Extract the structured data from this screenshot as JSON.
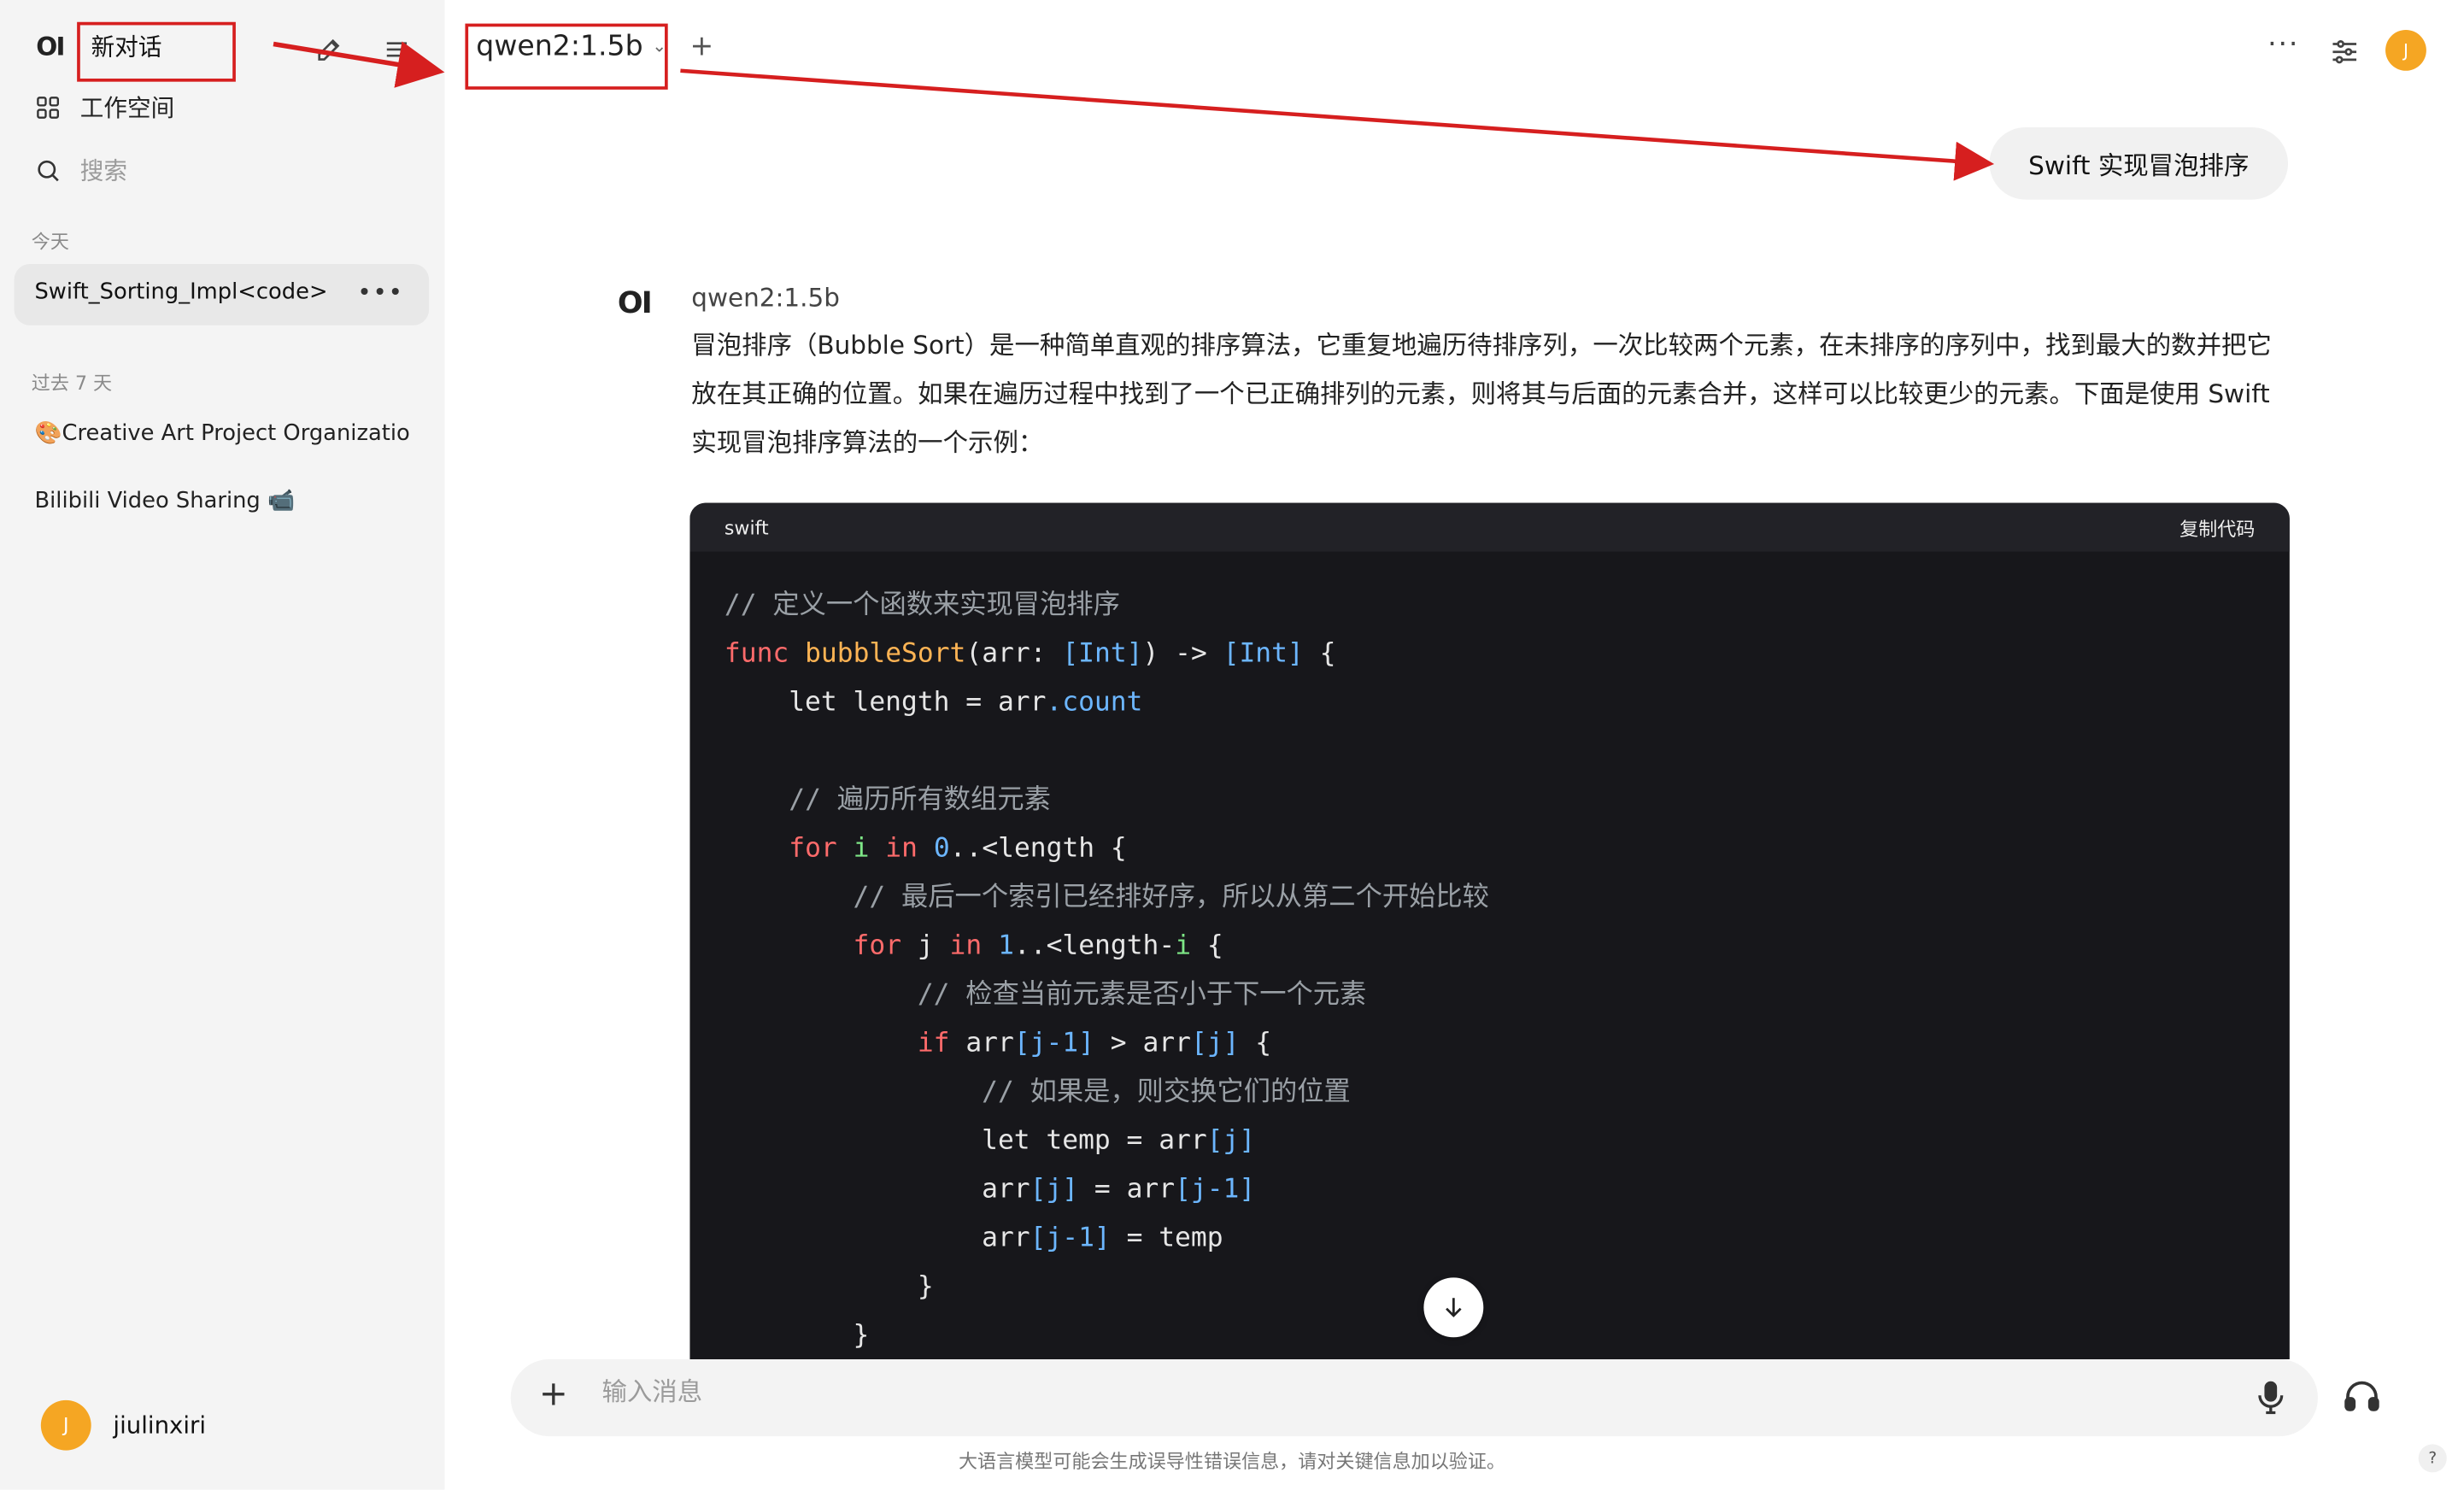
{
  "sidebar": {
    "logo": "OI",
    "new_chat": "新对话",
    "workspace": "工作空间",
    "search_placeholder": "搜索",
    "section_today": "今天",
    "today_items": [
      "Swift_Sorting_Impl<code>"
    ],
    "section_past7": "过去 7 天",
    "past_items": [
      "🎨Creative Art Project Organization",
      "Bilibili Video Sharing 📹"
    ],
    "user": {
      "initial": "J",
      "name": "jiulinxiri"
    }
  },
  "header": {
    "model": "qwen2:1.5b",
    "add_model": "+",
    "more": "···",
    "avatar_initial": "J"
  },
  "chat": {
    "user_message": "Swift 实现冒泡排序",
    "assistant": {
      "logo": "OI",
      "name": "qwen2:1.5b",
      "intro": "冒泡排序（Bubble Sort）是一种简单直观的排序算法，它重复地遍历待排序列，一次比较两个元素，在未排序的序列中，找到最大的数并把它放在其正确的位置。如果在遍历过程中找到了一个已正确排列的元素，则将其与后面的元素合并，这样可以比较更少的元素。下面是使用 Swift 实现冒泡排序算法的一个示例：",
      "code": {
        "language": "swift",
        "copy_label": "复制代码",
        "lines": [
          "// 定义一个函数来实现冒泡排序",
          "func bubbleSort(arr: [Int]) -> [Int] {",
          "    let length = arr.count",
          "",
          "    // 遍历所有数组元素",
          "    for i in 0..<length {",
          "        // 最后一个索引已经排好序，所以从第二个开始比较",
          "        for j in 1..<length-i {",
          "            // 检查当前元素是否小于下一个元素",
          "            if arr[j-1] > arr[j] {",
          "                // 如果是，则交换它们的位置",
          "                let temp = arr[j]",
          "                arr[j] = arr[j-1]",
          "                arr[j-1] = temp",
          "            }",
          "        }"
        ]
      }
    }
  },
  "input": {
    "placeholder": "输入消息",
    "add": "+"
  },
  "footer": {
    "disclaimer": "大语言模型可能会生成误导性错误信息，请对关键信息加以验证。",
    "help": "?"
  },
  "colors": {
    "annotation": "#d61f1f",
    "avatar": "#f5a623",
    "code_bg": "#17171b"
  }
}
